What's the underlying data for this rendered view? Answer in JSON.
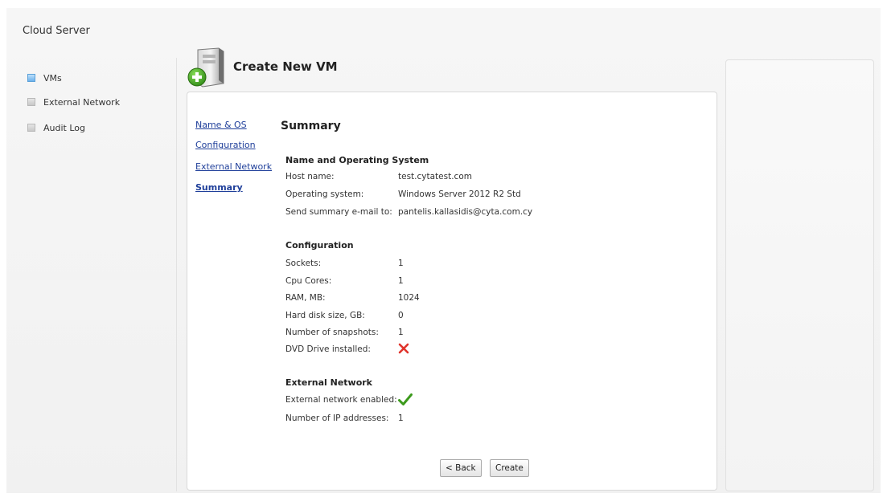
{
  "app": {
    "title": "Cloud Server"
  },
  "sidebar": {
    "items": [
      {
        "label": "VMs",
        "active": true
      },
      {
        "label": "External Network",
        "active": false
      },
      {
        "label": "Audit Log",
        "active": false
      }
    ]
  },
  "header": {
    "title": "Create New VM",
    "icon": "server-add-icon"
  },
  "wizard": {
    "steps": [
      {
        "label": "Name & OS",
        "current": false
      },
      {
        "label": "Configuration",
        "current": false
      },
      {
        "label": "External Network",
        "current": false
      },
      {
        "label": "Summary",
        "current": true
      }
    ]
  },
  "summary": {
    "title": "Summary",
    "name_os": {
      "heading": "Name and Operating System",
      "host_name_label": "Host name:",
      "host_name": "test.cytatest.com",
      "os_label": "Operating system:",
      "os": "Windows Server 2012 R2 Std",
      "email_label": "Send summary e-mail to:",
      "email": "pantelis.kallasidis@cyta.com.cy"
    },
    "configuration": {
      "heading": "Configuration",
      "sockets_label": "Sockets:",
      "sockets": "1",
      "cores_label": "Cpu Cores:",
      "cores": "1",
      "ram_label": "RAM, MB:",
      "ram": "1024",
      "disk_label": "Hard disk size, GB:",
      "disk": "0",
      "snapshots_label": "Number of snapshots:",
      "snapshots": "1",
      "dvd_label": "DVD Drive installed:",
      "dvd_installed": false
    },
    "external_network": {
      "heading": "External Network",
      "enabled_label": "External network enabled:",
      "enabled": true,
      "ip_label": "Number of IP addresses:",
      "ip_count": "1"
    }
  },
  "buttons": {
    "back": "< Back",
    "create": "Create"
  },
  "colors": {
    "link": "#1f3f9a",
    "no": "#e0342c",
    "yes": "#3c9a1c",
    "nav_active": "#6cb2ec"
  }
}
